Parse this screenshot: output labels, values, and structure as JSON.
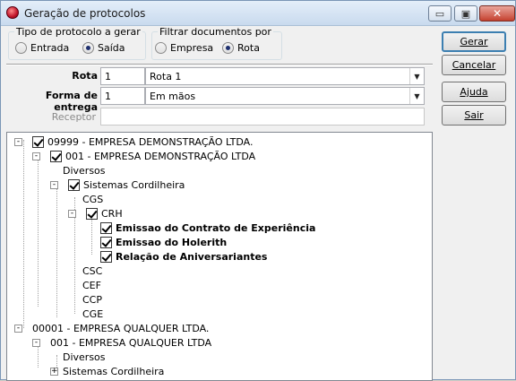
{
  "window": {
    "title": "Geração de protocolos"
  },
  "title_buttons": {
    "minimize": "▭",
    "maximize": "▣",
    "close": "✕"
  },
  "tipo": {
    "title": "Tipo de protocolo a gerar",
    "options": [
      "Entrada",
      "Saída"
    ],
    "selected": "Saída"
  },
  "filtro": {
    "title": "Filtrar documentos por",
    "options": [
      "Empresa",
      "Rota"
    ],
    "selected": "Rota"
  },
  "form": {
    "rota_label": "Rota",
    "rota_code": "1",
    "rota_value": "Rota 1",
    "forma_label": "Forma de entrega",
    "forma_code": "1",
    "forma_value": "Em mãos",
    "receptor_label": "Receptor",
    "receptor_value": ""
  },
  "buttons": {
    "gerar": "Gerar",
    "cancelar": "Cancelar",
    "ajuda": "Ajuda",
    "sair": "Sair"
  },
  "tree": [
    {
      "label": "09999 - EMPRESA DEMONSTRAÇÃO LTDA.",
      "checkbox": true,
      "checked": true,
      "expander": "-"
    },
    {
      "label": "001 - EMPRESA DEMONSTRAÇÃO LTDA",
      "checkbox": true,
      "checked": true,
      "expander": "-"
    },
    {
      "label": "Diversos",
      "checkbox": false
    },
    {
      "label": "Sistemas Cordilheira",
      "checkbox": true,
      "checked": true,
      "expander": "-"
    },
    {
      "label": "CGS",
      "checkbox": false
    },
    {
      "label": "CRH",
      "checkbox": true,
      "checked": true,
      "expander": "-"
    },
    {
      "label": "Emissao do Contrato de Experiência",
      "checkbox": true,
      "checked": true,
      "bold": true
    },
    {
      "label": "Emissao do Holerith",
      "checkbox": true,
      "checked": true,
      "bold": true
    },
    {
      "label": "Relação de Aniversariantes",
      "checkbox": true,
      "checked": true,
      "bold": true
    },
    {
      "label": "CSC",
      "checkbox": false
    },
    {
      "label": "CEF",
      "checkbox": false
    },
    {
      "label": "CCP",
      "checkbox": false
    },
    {
      "label": "CGE",
      "checkbox": false
    },
    {
      "label": "00001 - EMPRESA QUALQUER LTDA.",
      "checkbox": false,
      "expander": "-"
    },
    {
      "label": "001 - EMPRESA QUALQUER LTDA",
      "checkbox": false,
      "expander": "-"
    },
    {
      "label": "Diversos",
      "checkbox": false
    },
    {
      "label": "Sistemas Cordilheira",
      "checkbox": false,
      "expander": "+"
    }
  ]
}
